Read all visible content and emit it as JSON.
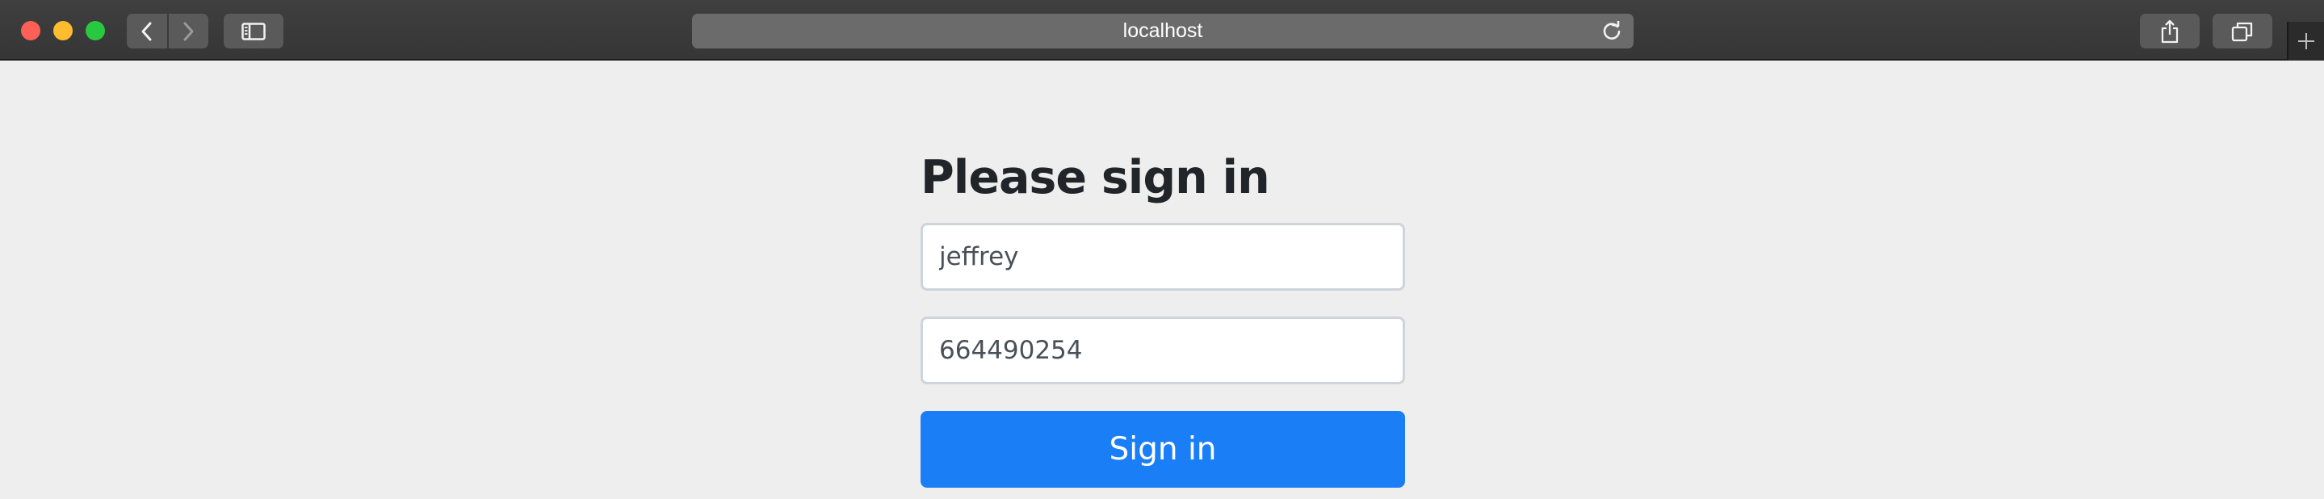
{
  "browser": {
    "address": "localhost",
    "icons": {
      "back": "chevron-left-icon",
      "forward": "chevron-right-icon",
      "sidebar": "sidebar-icon",
      "reload": "reload-icon",
      "share": "share-icon",
      "tabs": "tab-overview-icon",
      "new_tab": "plus-icon"
    },
    "colors": {
      "close": "#fe5f57",
      "minimize": "#febc2e",
      "zoom": "#28c840"
    }
  },
  "signin": {
    "heading": "Please sign in",
    "username_value": "jeffrey",
    "password_value": "664490254",
    "submit_label": "Sign in",
    "accent_color": "#1a7ef7"
  }
}
